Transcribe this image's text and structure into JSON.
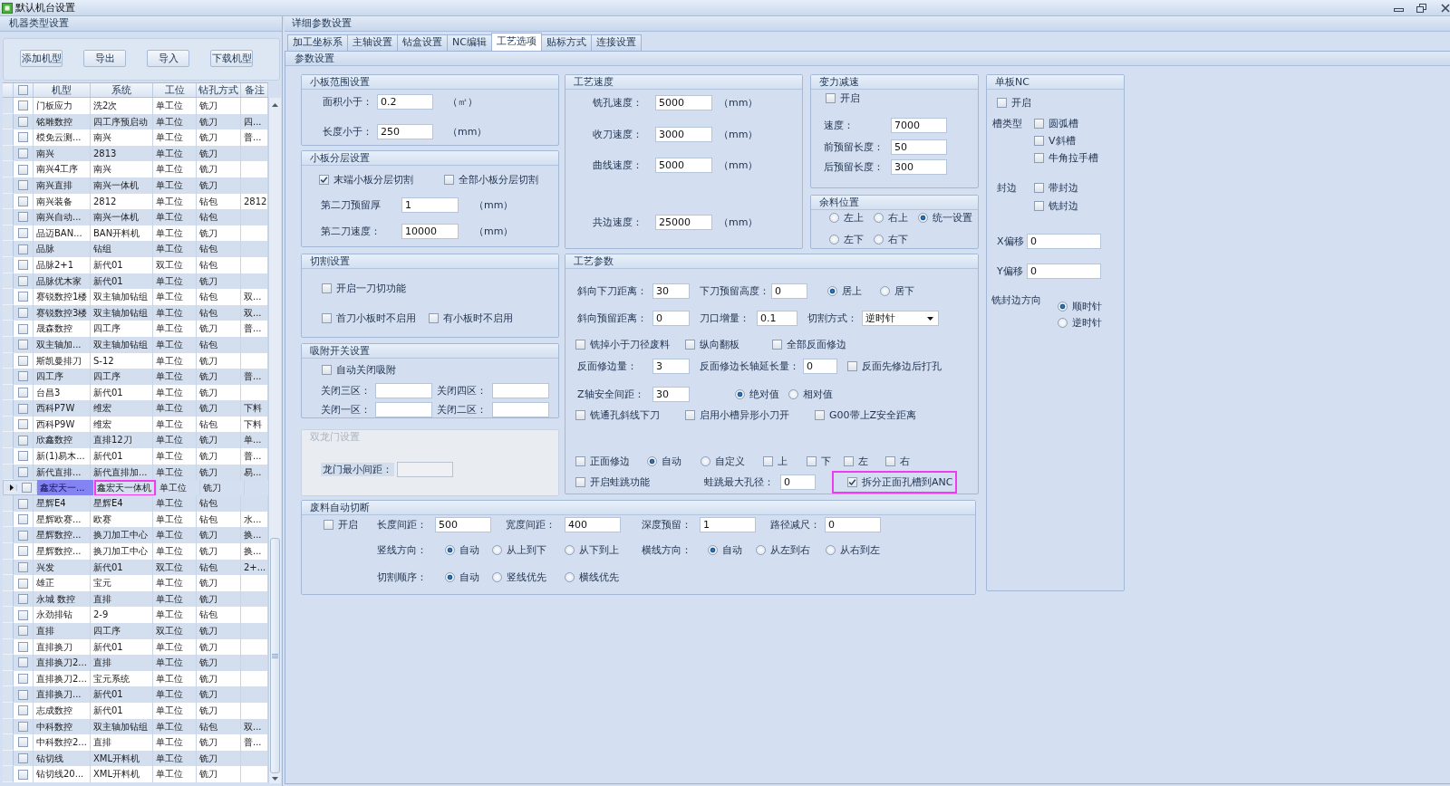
{
  "window": {
    "title": "默认机台设置"
  },
  "machine_types": {
    "title": "机器类型设置",
    "buttons": [
      "添加机型",
      "导出",
      "导入",
      "下载机型"
    ],
    "header_checked": false,
    "columns": [
      "机型",
      "系统",
      "工位",
      "钻孔方式",
      "备注"
    ],
    "rows": [
      {
        "model": "门板应力",
        "system": "洗2次",
        "station": "单工位",
        "drill": "铣刀",
        "checked": false,
        "selected": false,
        "outlined": false
      },
      {
        "model": "铭雕数控",
        "system": "四工序预启动",
        "station": "单工位",
        "drill": "铣刀",
        "note": "四...",
        "checked": false,
        "selected": false,
        "outlined": false
      },
      {
        "model": "模免云测...",
        "system": "南兴",
        "station": "单工位",
        "drill": "铣刀",
        "note": "普...",
        "checked": false,
        "selected": false,
        "outlined": false
      },
      {
        "model": "南兴",
        "system": "2813",
        "station": "单工位",
        "drill": "铣刀",
        "checked": false,
        "selected": false,
        "outlined": false
      },
      {
        "model": "南兴4工序",
        "system": "南兴",
        "station": "单工位",
        "drill": "铣刀",
        "checked": false,
        "selected": false,
        "outlined": false
      },
      {
        "model": "南兴直排",
        "system": "南兴一体机",
        "station": "单工位",
        "drill": "铣刀",
        "checked": false,
        "selected": false,
        "outlined": false
      },
      {
        "model": "南兴装备",
        "system": "2812",
        "station": "单工位",
        "drill": "钻包",
        "note": "2812",
        "checked": false,
        "selected": false,
        "outlined": false
      },
      {
        "model": "南兴自动...",
        "system": "南兴一体机",
        "station": "单工位",
        "drill": "钻包",
        "checked": false,
        "selected": false,
        "outlined": false
      },
      {
        "model": "品迈BAN...",
        "system": "BAN开料机",
        "station": "单工位",
        "drill": "铣刀",
        "checked": false,
        "selected": false,
        "outlined": false
      },
      {
        "model": "品脉",
        "system": "钻组",
        "station": "单工位",
        "drill": "钻包",
        "checked": false,
        "selected": false,
        "outlined": false
      },
      {
        "model": "品脉2+1",
        "system": "新代01",
        "station": "双工位",
        "drill": "钻包",
        "checked": false,
        "selected": false,
        "outlined": false
      },
      {
        "model": "品脉优木家",
        "system": "新代01",
        "station": "单工位",
        "drill": "铣刀",
        "checked": false,
        "selected": false,
        "outlined": false
      },
      {
        "model": "赛锐数控1楼",
        "system": "双主轴加钻组",
        "station": "单工位",
        "drill": "钻包",
        "note": "双...",
        "checked": false,
        "selected": false,
        "outlined": false
      },
      {
        "model": "赛锐数控3楼",
        "system": "双主轴加钻组",
        "station": "单工位",
        "drill": "钻包",
        "note": "双...",
        "checked": false,
        "selected": false,
        "outlined": false
      },
      {
        "model": "晟森数控",
        "system": "四工序",
        "station": "单工位",
        "drill": "铣刀",
        "note": "普...",
        "checked": false,
        "selected": false,
        "outlined": false
      },
      {
        "model": "双主轴加...",
        "system": "双主轴加钻组",
        "station": "单工位",
        "drill": "钻包",
        "checked": false,
        "selected": false,
        "outlined": false
      },
      {
        "model": "斯凯曼排刀",
        "system": "S-12",
        "station": "单工位",
        "drill": "铣刀",
        "checked": false,
        "selected": false,
        "outlined": false
      },
      {
        "model": "四工序",
        "system": "四工序",
        "station": "单工位",
        "drill": "铣刀",
        "note": "普...",
        "checked": false,
        "selected": false,
        "outlined": false
      },
      {
        "model": "台昌3",
        "system": "新代01",
        "station": "单工位",
        "drill": "铣刀",
        "checked": false,
        "selected": false,
        "outlined": false
      },
      {
        "model": "西科P7W",
        "system": "维宏",
        "station": "单工位",
        "drill": "铣刀",
        "note": "下料",
        "checked": false,
        "selected": false,
        "outlined": false
      },
      {
        "model": "西科P9W",
        "system": "维宏",
        "station": "单工位",
        "drill": "钻包",
        "note": "下料",
        "checked": false,
        "selected": false,
        "outlined": false
      },
      {
        "model": "欣鑫数控",
        "system": "直排12刀",
        "station": "单工位",
        "drill": "铣刀",
        "note": "单...",
        "checked": false,
        "selected": false,
        "outlined": false
      },
      {
        "model": "新(1)易木...",
        "system": "新代01",
        "station": "单工位",
        "drill": "铣刀",
        "note": "普...",
        "checked": false,
        "selected": false,
        "outlined": false
      },
      {
        "model": "新代直排...",
        "system": "新代直排加...",
        "station": "单工位",
        "drill": "铣刀",
        "note": "易...",
        "checked": false,
        "selected": false,
        "outlined": false
      },
      {
        "model": "鑫宏天一...",
        "system": "鑫宏天一体机",
        "station": "单工位",
        "drill": "铣刀",
        "checked": false,
        "selected": true,
        "outlined": true
      },
      {
        "model": "星辉E4",
        "system": "星辉E4",
        "station": "单工位",
        "drill": "钻包",
        "checked": false,
        "selected": false,
        "outlined": false
      },
      {
        "model": "星辉欧赛...",
        "system": "欧赛",
        "station": "单工位",
        "drill": "钻包",
        "note": "水...",
        "checked": false,
        "selected": false,
        "outlined": false
      },
      {
        "model": "星辉数控...",
        "system": "换刀加工中心",
        "station": "单工位",
        "drill": "铣刀",
        "note": "换...",
        "checked": false,
        "selected": false,
        "outlined": false
      },
      {
        "model": "星辉数控...",
        "system": "换刀加工中心",
        "station": "单工位",
        "drill": "铣刀",
        "note": "换...",
        "checked": false,
        "selected": false,
        "outlined": false
      },
      {
        "model": "兴发",
        "system": "新代01",
        "station": "双工位",
        "drill": "钻包",
        "note": "2+...",
        "checked": false,
        "selected": false,
        "outlined": false
      },
      {
        "model": "雄正",
        "system": "宝元",
        "station": "单工位",
        "drill": "铣刀",
        "checked": false,
        "selected": false,
        "outlined": false
      },
      {
        "model": "永城 数控",
        "system": "直排",
        "station": "单工位",
        "drill": "铣刀",
        "checked": false,
        "selected": false,
        "outlined": false
      },
      {
        "model": "永劲排钻",
        "system": "2-9",
        "station": "单工位",
        "drill": "钻包",
        "checked": false,
        "selected": false,
        "outlined": false
      },
      {
        "model": "直排",
        "system": "四工序",
        "station": "双工位",
        "drill": "铣刀",
        "checked": false,
        "selected": false,
        "outlined": false
      },
      {
        "model": "直排换刀",
        "system": "新代01",
        "station": "单工位",
        "drill": "铣刀",
        "checked": false,
        "selected": false,
        "outlined": false
      },
      {
        "model": "直排换刀2...",
        "system": "直排",
        "station": "单工位",
        "drill": "铣刀",
        "checked": false,
        "selected": false,
        "outlined": false
      },
      {
        "model": "直排换刀2...",
        "system": "宝元系统",
        "station": "单工位",
        "drill": "铣刀",
        "checked": false,
        "selected": false,
        "outlined": false
      },
      {
        "model": "直排换刀...",
        "system": "新代01",
        "station": "单工位",
        "drill": "铣刀",
        "checked": false,
        "selected": false,
        "outlined": false
      },
      {
        "model": "志成数控",
        "system": "新代01",
        "station": "单工位",
        "drill": "铣刀",
        "checked": false,
        "selected": false,
        "outlined": false
      },
      {
        "model": "中科数控",
        "system": "双主轴加钻组",
        "station": "单工位",
        "drill": "钻包",
        "note": "双...",
        "checked": false,
        "selected": false,
        "outlined": false
      },
      {
        "model": "中科数控2...",
        "system": "直排",
        "station": "单工位",
        "drill": "铣刀",
        "note": "普...",
        "checked": false,
        "selected": false,
        "outlined": false
      },
      {
        "model": "钻切线",
        "system": "XML开料机",
        "station": "单工位",
        "drill": "铣刀",
        "checked": false,
        "selected": false,
        "outlined": false
      },
      {
        "model": "钻切线20...",
        "system": "XML开料机",
        "station": "单工位",
        "drill": "铣刀",
        "checked": false,
        "selected": false,
        "outlined": false
      }
    ]
  },
  "details": {
    "title": "详细参数设置",
    "tabs": [
      {
        "label": "加工坐标系",
        "selected": false
      },
      {
        "label": "主轴设置",
        "selected": false
      },
      {
        "label": "钻盒设置",
        "selected": false
      },
      {
        "label": "NC编辑",
        "selected": false
      },
      {
        "label": "工艺选项",
        "selected": true
      },
      {
        "label": "贴标方式",
        "selected": false
      },
      {
        "label": "连接设置",
        "selected": false
      }
    ],
    "section_title": "参数设置"
  },
  "small_board_range": {
    "title": "小板范围设置",
    "rows": [
      {
        "label": "面积小于：",
        "value": "0.2",
        "unit": "（㎡）"
      },
      {
        "label": "长度小于：",
        "value": "250",
        "unit": "（mm）"
      }
    ]
  },
  "small_board_layering": {
    "title": "小板分层设置",
    "options": [
      {
        "label": "末端小板分层切割",
        "checked": true
      },
      {
        "label": "全部小板分层切割",
        "checked": false
      }
    ],
    "rows": [
      {
        "label": "第二刀预留厚",
        "value": "1",
        "unit": "（mm）"
      },
      {
        "label": "第二刀速度：",
        "value": "10000",
        "unit": "（mm）"
      }
    ]
  },
  "cutting": {
    "title": "切割设置",
    "option_rows": [
      [
        {
          "label": "开启一刀切功能",
          "checked": false
        }
      ],
      [
        {
          "label": "首刀小板时不启用",
          "checked": false
        },
        {
          "label": "有小板时不启用",
          "checked": false
        }
      ]
    ]
  },
  "suction": {
    "title": "吸附开关设置",
    "option": {
      "label": "自动关闭吸附",
      "checked": false
    },
    "zone_rows": [
      [
        {
          "label": "关闭三区："
        },
        {
          "label": "关闭四区："
        }
      ],
      [
        {
          "label": "关闭一区："
        },
        {
          "label": "关闭二区："
        }
      ]
    ]
  },
  "double_gantry": {
    "title": "双龙门设置",
    "disabled": true,
    "field": {
      "label": "龙门最小间距："
    }
  },
  "process_speed": {
    "title": "工艺速度",
    "rows": [
      {
        "label": "铣孔速度：",
        "value": "5000",
        "unit": "（mm）"
      },
      {
        "label": "收刀速度：",
        "value": "3000",
        "unit": "（mm）"
      },
      {
        "label": "曲线速度：",
        "value": "5000",
        "unit": "（mm）"
      },
      {
        "label": "共边速度：",
        "value": "25000",
        "unit": "（mm）"
      }
    ]
  },
  "force_slowdown": {
    "title": "变力减速",
    "option": {
      "label": "开启",
      "checked": false
    },
    "rows": [
      {
        "label": "速度：",
        "value": "7000"
      },
      {
        "label": "前预留长度：",
        "value": "50"
      },
      {
        "label": "后预留长度：",
        "value": "300"
      }
    ]
  },
  "remainder_position": {
    "title": "余料位置",
    "option_rows": [
      [
        {
          "label": "左上",
          "selected": false
        },
        {
          "label": "右上",
          "selected": false
        },
        {
          "label": "统一设置",
          "selected": true
        }
      ],
      [
        {
          "label": "左下",
          "selected": false
        },
        {
          "label": "右下",
          "selected": false
        }
      ]
    ]
  },
  "process_params": {
    "title": "工艺参数",
    "ramp_distance": {
      "label": "斜向下刀距离：",
      "value": "30"
    },
    "drop_height": {
      "label": "下刀预留高度：",
      "value": "0"
    },
    "drop_position": [
      {
        "label": "居上",
        "selected": true
      },
      {
        "label": "居下",
        "selected": false
      }
    ],
    "ramp_reserve": {
      "label": "斜向预留距离：",
      "value": "0"
    },
    "edge_increment": {
      "label": "刀口增量：",
      "value": "0.1"
    },
    "cut_mode": {
      "label": "切割方式：",
      "value": "逆时针"
    },
    "options_a": [
      {
        "label": "铣掉小于刀径废料",
        "checked": false
      },
      {
        "label": "纵向翻板",
        "checked": false
      },
      {
        "label": "全部反面修边",
        "checked": false
      }
    ],
    "back_trim": {
      "label": "反面修边量：",
      "value": "3"
    },
    "back_trim_extension": {
      "label": "反面修边长轴延长量：",
      "value": "0"
    },
    "trim_before_drill": {
      "label": "反面先修边后打孔",
      "checked": false
    },
    "z_safe": {
      "label": "Z轴安全间距：",
      "value": "30"
    },
    "z_mode": [
      {
        "label": "绝对值",
        "selected": true
      },
      {
        "label": "相对值",
        "selected": false
      }
    ],
    "options_b": [
      {
        "label": "铣通孔斜线下刀",
        "checked": false
      },
      {
        "label": "启用小槽异形小刀开",
        "checked": false
      },
      {
        "label": "G00带上Z安全距离",
        "checked": false
      }
    ],
    "front_trim": {
      "label": "正面修边",
      "checked": false
    },
    "front_trim_mode": [
      {
        "label": "自动",
        "selected": true
      },
      {
        "label": "自定义",
        "selected": false
      }
    ],
    "front_trim_sides": [
      {
        "label": "上",
        "checked": false
      },
      {
        "label": "下",
        "checked": false
      },
      {
        "label": "左",
        "checked": false
      },
      {
        "label": "右",
        "checked": false
      }
    ],
    "frog_jump": {
      "label": "开启蛙跳功能",
      "checked": false
    },
    "frog_jump_max": {
      "label": "蛙跳最大孔径：",
      "value": "0"
    },
    "split_to_anc": {
      "label": "拆分正面孔槽到ANC",
      "checked": true,
      "outlined": true
    }
  },
  "single_board_nc": {
    "title": "单板NC",
    "option": {
      "label": "开启",
      "checked": false
    },
    "slot_type": {
      "label": "槽类型",
      "options": [
        {
          "label": "圆弧槽",
          "checked": false
        },
        {
          "label": "V斜槽",
          "checked": false
        },
        {
          "label": "牛角拉手槽",
          "checked": false
        }
      ]
    },
    "edge_banding": {
      "label": "封边",
      "options": [
        {
          "label": "带封边",
          "checked": false
        },
        {
          "label": "铣封边",
          "checked": false
        }
      ]
    },
    "offsets": [
      {
        "label": "X偏移",
        "value": "0"
      },
      {
        "label": "Y偏移",
        "value": "0"
      }
    ],
    "edge_direction": {
      "label": "铣封边方向",
      "options": [
        {
          "label": "顺时针",
          "selected": true
        },
        {
          "label": "逆时针",
          "selected": false
        }
      ]
    }
  },
  "scrap_cutting": {
    "title": "废料自动切断",
    "option": {
      "label": "开启",
      "checked": false
    },
    "fields": [
      {
        "label": "长度间距：",
        "value": "500"
      },
      {
        "label": "宽度间距：",
        "value": "400"
      },
      {
        "label": "深度预留：",
        "value": "1"
      },
      {
        "label": "路径减尺：",
        "value": "0"
      }
    ],
    "directions": [
      {
        "label": "竖线方向：",
        "options": [
          {
            "label": "自动",
            "selected": true
          },
          {
            "label": "从上到下",
            "selected": false
          },
          {
            "label": "从下到上",
            "selected": false
          }
        ]
      },
      {
        "label": "横线方向：",
        "options": [
          {
            "label": "自动",
            "selected": true
          },
          {
            "label": "从左到右",
            "selected": false
          },
          {
            "label": "从右到左",
            "selected": false
          }
        ]
      }
    ],
    "order": {
      "label": "切割顺序：",
      "options": [
        {
          "label": "自动",
          "selected": true
        },
        {
          "label": "竖线优先",
          "selected": false
        },
        {
          "label": "横线优先",
          "selected": false
        }
      ]
    }
  }
}
